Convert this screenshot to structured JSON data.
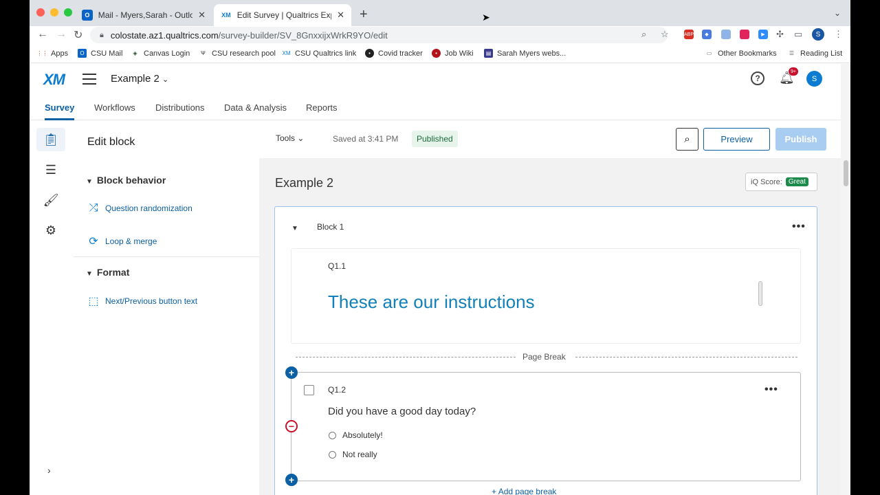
{
  "browser": {
    "tabs": [
      {
        "title": "Mail - Myers,Sarah - Outlook",
        "favicon": "outlook-icon"
      },
      {
        "title": "Edit Survey | Qualtrics Experience",
        "favicon": "xm-icon"
      }
    ],
    "url_host": "colostate.az1.qualtrics.com",
    "url_path": "/survey-builder/SV_8GnxxijxWrkR9YO/edit",
    "profile_initial": "S",
    "bookmarks": [
      "Apps",
      "CSU Mail",
      "Canvas Login",
      "CSU research pool",
      "CSU Qualtrics link",
      "Covid tracker",
      "Job Wiki",
      "Sarah Myers webs...",
      "Other Bookmarks",
      "Reading List"
    ]
  },
  "app": {
    "logo": "XM",
    "project_name": "Example 2",
    "notification_badge": "9+",
    "user_initial": "S",
    "nav_tabs": [
      "Survey",
      "Workflows",
      "Distributions",
      "Data & Analysis",
      "Reports"
    ]
  },
  "panel": {
    "title": "Edit block",
    "block_behavior": "Block behavior",
    "question_randomization": "Question randomization",
    "loop_merge": "Loop & merge",
    "format": "Format",
    "next_prev_text": "Next/Previous button text"
  },
  "toolbar": {
    "tools": "Tools",
    "saved": "Saved at 3:41 PM",
    "status": "Published",
    "preview": "Preview",
    "publish": "Publish"
  },
  "survey": {
    "name": "Example 2",
    "iq_label": "iQ Score:",
    "iq_value": "Great",
    "block_name": "Block 1",
    "page_break": "Page Break",
    "add_page_break": "Add page break",
    "q1": {
      "id": "Q1.1",
      "text": "These are our instructions"
    },
    "q2": {
      "id": "Q1.2",
      "text": "Did you have a good day today?",
      "options": [
        "Absolutely!",
        "Not really"
      ]
    }
  },
  "colors": {
    "accent": "#0b5fa3",
    "brand": "#0b7cd1",
    "published_bg": "#e6f4ec",
    "remove": "#c8102e"
  }
}
